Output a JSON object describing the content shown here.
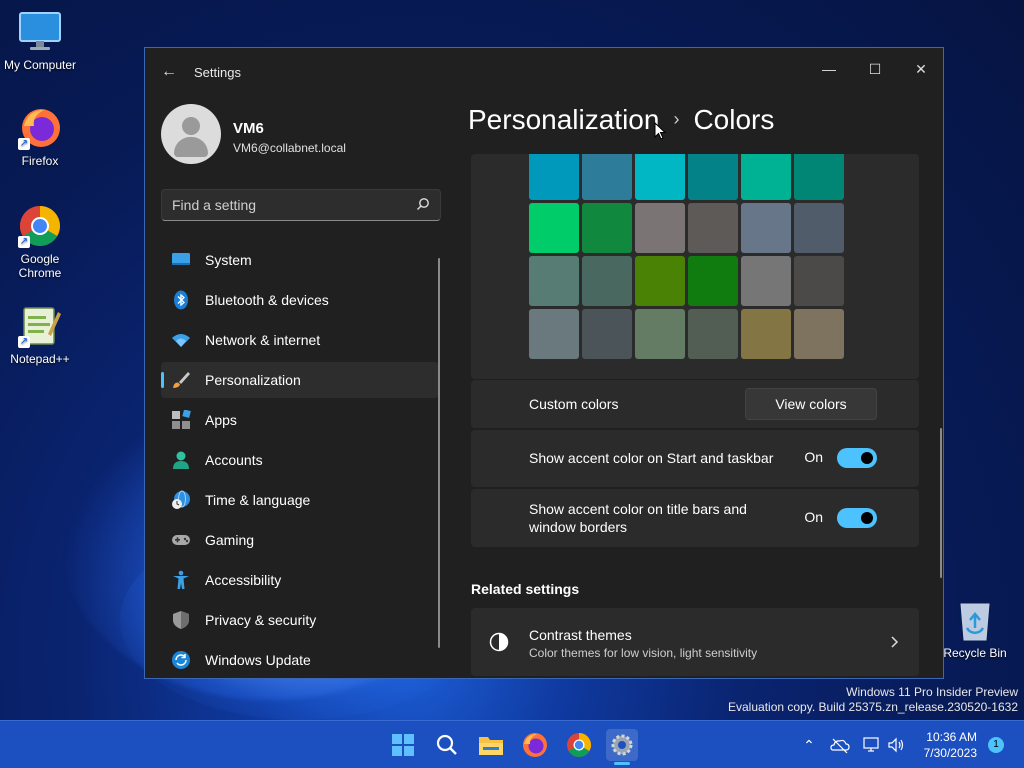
{
  "desktop": {
    "icons": [
      {
        "label": "My Computer",
        "icon": "monitor-icon"
      },
      {
        "label": "Firefox",
        "icon": "firefox-icon"
      },
      {
        "label": "Google Chrome",
        "icon": "chrome-icon"
      },
      {
        "label": "Notepad++",
        "icon": "notepadpp-icon"
      },
      {
        "label": "Recycle Bin",
        "icon": "recycle-bin-icon"
      }
    ],
    "watermark": {
      "line1": "Windows 11 Pro Insider Preview",
      "line2": "Evaluation copy. Build 25375.zn_release.230520-1632"
    }
  },
  "window": {
    "title": "Settings",
    "controls": [
      "minimize",
      "maximize",
      "close"
    ]
  },
  "profile": {
    "name": "VM6",
    "email": "VM6@collabnet.local"
  },
  "search": {
    "placeholder": "Find a setting"
  },
  "nav": {
    "items": [
      {
        "label": "System",
        "icon": "system-icon"
      },
      {
        "label": "Bluetooth & devices",
        "icon": "bluetooth-icon"
      },
      {
        "label": "Network & internet",
        "icon": "wifi-icon"
      },
      {
        "label": "Personalization",
        "icon": "brush-icon",
        "selected": true
      },
      {
        "label": "Apps",
        "icon": "apps-icon"
      },
      {
        "label": "Accounts",
        "icon": "accounts-icon"
      },
      {
        "label": "Time & language",
        "icon": "globe-clock-icon"
      },
      {
        "label": "Gaming",
        "icon": "gamepad-icon"
      },
      {
        "label": "Accessibility",
        "icon": "accessibility-icon"
      },
      {
        "label": "Privacy & security",
        "icon": "shield-icon"
      },
      {
        "label": "Windows Update",
        "icon": "update-icon"
      }
    ]
  },
  "breadcrumb": {
    "parent": "Personalization",
    "separator": "›",
    "current": "Colors"
  },
  "swatches": {
    "colors": [
      [
        "#0099bc",
        "#2d7d9a",
        "#00b7c3",
        "#038387",
        "#00b294",
        "#018574"
      ],
      [
        "#00cc6a",
        "#10893e",
        "#7a7574",
        "#5d5a58",
        "#68768a",
        "#515c6b"
      ],
      [
        "#567c73",
        "#486860",
        "#498205",
        "#107c10",
        "#767676",
        "#4c4a48"
      ],
      [
        "#69797e",
        "#4a5459",
        "#647c64",
        "#525e54",
        "#847545",
        "#7e735f"
      ]
    ]
  },
  "custom_colors": {
    "label": "Custom colors",
    "button": "View colors"
  },
  "toggles": [
    {
      "label": "Show accent color on Start and taskbar",
      "state": "On",
      "on": true
    },
    {
      "label": "Show accent color on title bars and window borders",
      "state": "On",
      "on": true
    }
  ],
  "related": {
    "heading": "Related settings",
    "item": {
      "title": "Contrast themes",
      "subtitle": "Color themes for low vision, light sensitivity",
      "icon": "contrast-icon"
    }
  },
  "taskbar": {
    "apps": [
      "start-icon",
      "search-icon",
      "file-explorer-icon",
      "firefox-icon",
      "chrome-icon",
      "settings-icon"
    ],
    "active": "settings-icon",
    "tray": [
      "chevron-up-icon",
      "onedrive-icon",
      "network-icon",
      "volume-icon"
    ],
    "time": "10:36 AM",
    "date": "7/30/2023",
    "notifications": "1"
  },
  "colors": {
    "accent": "#4cc2ff",
    "window_bg": "#202020",
    "card_bg": "#2b2b2b",
    "taskbar_bg": "#1c4fbf"
  }
}
